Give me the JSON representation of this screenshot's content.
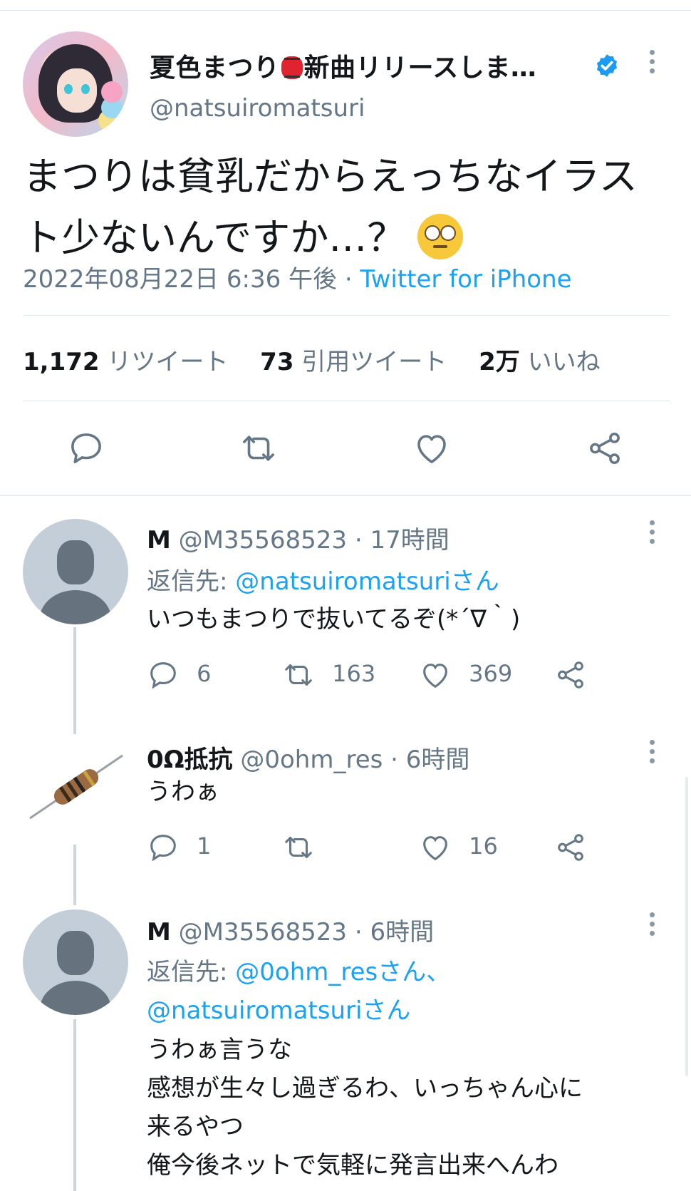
{
  "tweet": {
    "display_name": "夏色まつり",
    "display_name_rest": "新曲リリースしま…",
    "handle": "@natsuiromatsuri",
    "text_line1": "まつりは貧乳だからえっちなイラス",
    "text_line2": "ト少ないんですか…？",
    "timestamp": "2022年08月22日 6:36 午後 · ",
    "source": "Twitter for iPhone",
    "retweets_count": "1,172",
    "retweets_label": " リツイート",
    "quotes_count": "73",
    "quotes_label": " 引用ツイート",
    "likes_count": "2万",
    "likes_label": " いいね"
  },
  "replies": [
    {
      "name": "M",
      "handle_time": " @M35568523 · 17時間",
      "reply_to_prefix": "返信先: ",
      "reply_to_link": "@natsuiromatsuriさん",
      "text": "いつもまつりで抜いてるぞ(*´∇｀)",
      "replies": "6",
      "retweets": "163",
      "likes": "369"
    },
    {
      "name": "0Ω抵抗",
      "handle_time": " @0ohm_res · 6時間",
      "text": "うわぁ",
      "replies": "1",
      "retweets": "",
      "likes": "16"
    },
    {
      "name": "M",
      "handle_time": " @M35568523 · 6時間",
      "reply_to_prefix": "返信先: ",
      "reply_to_link": "@0ohm_resさん、",
      "reply_to_link2": "@natsuiromatsuriさん",
      "text_lines": [
        "うわぁ言うな",
        "感想が生々し過ぎるわ、いっちゃん心に",
        "来るやつ",
        "俺今後ネットで気軽に発言出来へんわ"
      ]
    }
  ],
  "colors": {
    "accent": "#1da1f2",
    "muted": "#657786",
    "text": "#14171a",
    "divider": "#e1e8ed",
    "verified": "#1d9bf0"
  },
  "icons": [
    "reply-icon",
    "retweet-icon",
    "like-icon",
    "share-icon",
    "verified-badge-icon",
    "more-icon",
    "lantern-emoji",
    "rolling-eyes-emoji"
  ]
}
